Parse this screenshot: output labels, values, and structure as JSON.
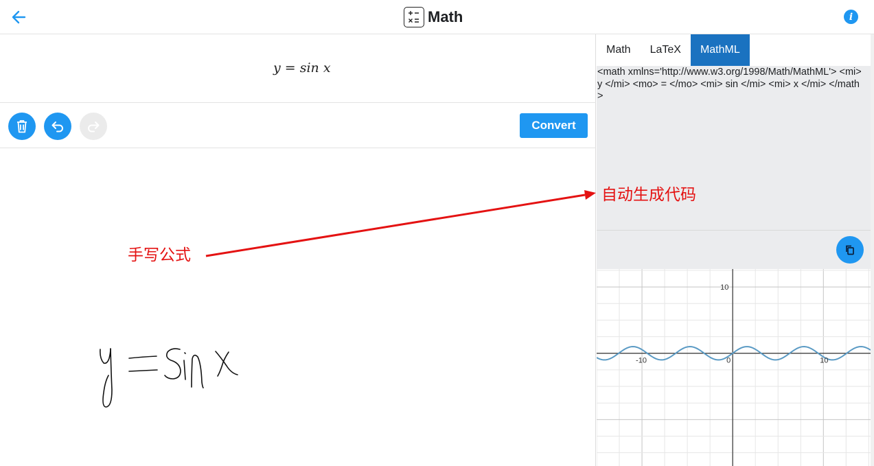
{
  "header": {
    "title": "Math",
    "back_icon": "arrow-left-icon",
    "info_icon": "info-icon",
    "info_glyph": "i",
    "app_icon": "calculator-icon",
    "accent_color": "#1f97f1"
  },
  "result": {
    "formula": "y = sin x"
  },
  "toolbar": {
    "clear_icon": "trash-icon",
    "undo_icon": "undo-icon",
    "redo_icon": "redo-icon",
    "convert_label": "Convert"
  },
  "annotations": {
    "handwriting_label": "手写公式",
    "autocode_label": "自动生成代码",
    "color": "#e41212"
  },
  "tabs": [
    {
      "label": "Math",
      "active": false
    },
    {
      "label": "LaTeX",
      "active": false
    },
    {
      "label": "MathML",
      "active": true
    }
  ],
  "code": {
    "mathml": "<math xmlns='http://www.w3.org/1998/Math/MathML'> <mi> y </mi> <mo> = </mo> <mi> sin </mi> <mi> x </mi> </math>",
    "copy_icon": "copy-icon"
  },
  "chart_data": {
    "type": "line",
    "title": "",
    "xlabel": "",
    "ylabel": "",
    "function": "y = sin x",
    "xlim": [
      -15,
      15.2
    ],
    "ylim": [
      -17,
      12.7
    ],
    "grid": true,
    "tick_labels": [
      {
        "axis": "y",
        "value": 10,
        "label": "10"
      },
      {
        "axis": "x",
        "value": -10,
        "label": "-10"
      },
      {
        "axis": "x",
        "value": 0,
        "label": "0"
      },
      {
        "axis": "x",
        "value": 10,
        "label": "10"
      }
    ],
    "series": [
      {
        "color": "#5a9ac4",
        "x": [
          -15,
          -12.5,
          -10,
          -7.5,
          -5,
          -2.5,
          0,
          2.5,
          5,
          7.5,
          10,
          12.5,
          15
        ],
        "values": [
          -0.65,
          0.07,
          0.54,
          -0.94,
          0.96,
          -0.6,
          0,
          0.6,
          -0.96,
          0.94,
          -0.54,
          -0.07,
          0.65
        ]
      }
    ]
  }
}
